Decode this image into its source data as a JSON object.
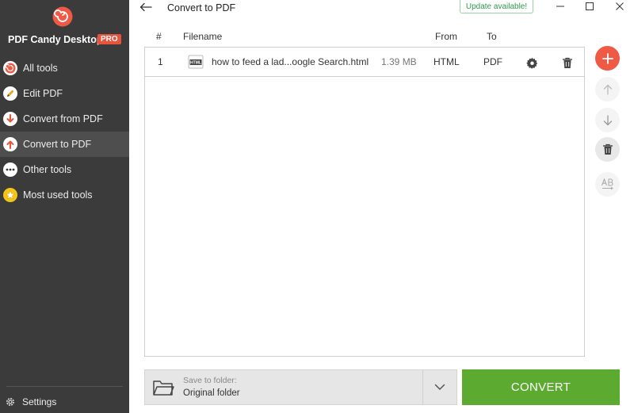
{
  "app": {
    "name": "PDF Candy Desktop",
    "badge": "PRO"
  },
  "sidebar": {
    "items": [
      {
        "label": "All tools",
        "icon": "lollipop-icon",
        "active": false
      },
      {
        "label": "Edit PDF",
        "icon": "pencil-icon",
        "active": false
      },
      {
        "label": "Convert from PDF",
        "icon": "arrow-down-icon",
        "active": false
      },
      {
        "label": "Convert to PDF",
        "icon": "arrow-up-icon",
        "active": true
      },
      {
        "label": "Other tools",
        "icon": "more-dots-icon",
        "active": false
      },
      {
        "label": "Most used tools",
        "icon": "star-icon",
        "active": false
      }
    ],
    "settings_label": "Settings"
  },
  "header": {
    "title": "Convert to PDF",
    "update_label": "Update available!"
  },
  "table": {
    "columns": {
      "index": "#",
      "filename": "Filename",
      "from": "From",
      "to": "To"
    },
    "rows": [
      {
        "index": "1",
        "file_type_icon_text": "HTML",
        "filename": "how to feed a lad...oogle Search.html",
        "size": "1.39 MB",
        "from": "HTML",
        "to": "PDF"
      }
    ]
  },
  "bottom": {
    "folder_label": "Save to folder:",
    "folder_value": "Original folder",
    "convert_label": "CONVERT"
  },
  "colors": {
    "sidebar_bg": "#3b3b3b",
    "accent_red": "#ee5a45",
    "convert_green": "#5caa2f",
    "update_green": "#2e9a4a"
  }
}
